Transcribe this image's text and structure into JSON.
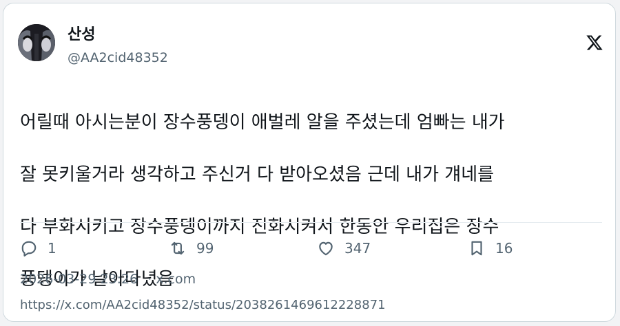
{
  "author": {
    "display_name": "산성",
    "handle": "@AA2cid48352"
  },
  "brand_icon": "x-logo-icon",
  "tweet": {
    "lines": [
      "어릴때 아시는분이 장수풍뎅이 애벌레 알을 주셨는데 엄빠는 내가",
      "잘 못키울거라 생각하고 주신거 다 받아오셨음 근데 내가 걔네를",
      "다 부화시키고 장수풍뎅이까지 진화시켜서 한동안 우리집은 장수",
      "풍뎅이가 날아다녔음"
    ]
  },
  "actions": {
    "reply_count": "1",
    "retweet_count": "99",
    "like_count": "347",
    "bookmark_count": "16"
  },
  "meta": {
    "timestamp": "2026-03-29 23:26",
    "separator": "·",
    "site": "x.com"
  },
  "url": "https://x.com/AA2cid48352/status/2038261469612228871",
  "colors": {
    "text": "#0f1419",
    "secondary": "#536471",
    "border": "#cfd9de"
  }
}
